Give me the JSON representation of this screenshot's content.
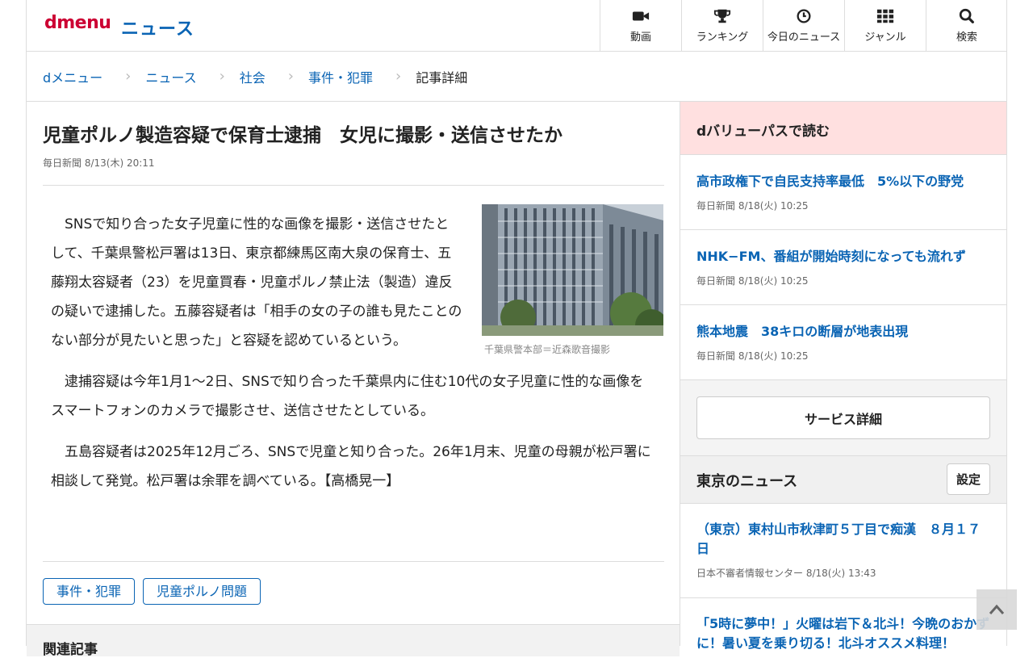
{
  "header": {
    "logo": "dmenu",
    "section": "ニュース",
    "nav": [
      {
        "label": "動画",
        "icon": "video-camera-icon"
      },
      {
        "label": "ランキング",
        "icon": "trophy-icon"
      },
      {
        "label": "今日のニュース",
        "icon": "clock-icon"
      },
      {
        "label": "ジャンル",
        "icon": "grid-icon"
      },
      {
        "label": "検索",
        "icon": "search-icon"
      }
    ]
  },
  "breadcrumb": {
    "items": [
      "dメニュー",
      "ニュース",
      "社会",
      "事件・犯罪"
    ],
    "current": "記事詳細"
  },
  "article": {
    "title": "児童ポルノ製造容疑で保育士逮捕　女児に撮影・送信させたか",
    "meta": "毎日新聞 8/13(木) 20:11",
    "p1": "SNSで知り合った女子児童に性的な画像を撮影・送信させたとして、千葉県警松戸署は13日、東京都練馬区南大泉の保育士、五藤翔太容疑者（23）を児童買春・児童ポルノ禁止法（製造）違反の疑いで逮捕した。五藤容疑者は「相手の女の子の誰も見たことのない部分が見たいと思った」と容疑を認めているという。",
    "p2": "逮捕容疑は今年1月1〜2日、SNSで知り合った千葉県内に住む10代の女子児童に性的な画像をスマートフォンのカメラで撮影させ、送信させたとしている。",
    "p3": "五島容疑者は2025年12月ごろ、SNSで児童と知り合った。26年1月末、児童の母親が松戸署に相談して発覚。松戸署は余罪を調べている。【高橋晃一】",
    "photo_caption": "千葉県警本部＝近森歌音撮影",
    "tags": [
      "事件・犯罪",
      "児童ポルノ問題"
    ],
    "related_title": "関連記事"
  },
  "sidebar": {
    "dvalue_title": "dバリューパスで読む",
    "dvalue_items": [
      {
        "title": "高市政権下で自民支持率最低　5%以下の野党",
        "meta": "毎日新聞 8/18(火) 10:25"
      },
      {
        "title": "NHK−FM、番組が開始時刻になっても流れず",
        "meta": "毎日新聞 8/18(火) 10:25"
      },
      {
        "title": "熊本地震　38キロの断層が地表出現",
        "meta": "毎日新聞 8/18(火) 10:25"
      }
    ],
    "service_button": "サービス詳細",
    "tokyo_title": "東京のニュース",
    "tokyo_settings": "設定",
    "tokyo_items": [
      {
        "title": "（東京）東村山市秋津町５丁目で痴漢　８月１７日",
        "meta": "日本不審者情報センター 8/18(火) 13:43"
      },
      {
        "title": "「5時に夢中！」火曜は岩下＆北斗！今晩のおかずに！暑い夏を乗り切る！北斗オススメ料理！"
      }
    ]
  }
}
